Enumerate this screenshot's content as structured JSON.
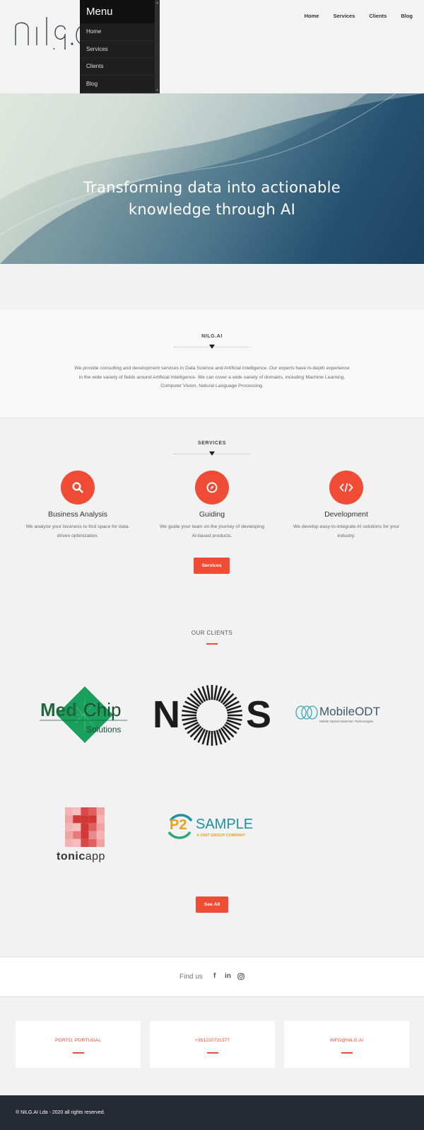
{
  "header": {
    "nav": [
      "Home",
      "Services",
      "Clients",
      "Blog"
    ]
  },
  "menu": {
    "title": "Menu",
    "items": [
      "Home",
      "Services",
      "Clients",
      "Blog"
    ]
  },
  "hero": {
    "line1": "Transforming data into actionable",
    "line2": "knowledge through AI"
  },
  "about": {
    "title": "NILG.AI",
    "text": "We provide consulting and development services in Data Science and Artificial Intelligence. Our experts have in-depth experience in the wide variety of fields around Artificial Intelligence. We can cover a wide variety of domains, including Machine Learning, Computer Vision, Natural Language Processing."
  },
  "services": {
    "title": "SERVICES",
    "items": [
      {
        "title": "Business Analysis",
        "desc": "We analyze your business to find space for data-driven optimization.",
        "icon": "search-icon"
      },
      {
        "title": "Guiding",
        "desc": "We guide your team on the journey of developing AI-based products.",
        "icon": "compass-icon"
      },
      {
        "title": "Development",
        "desc": "We develop easy-to-integrate AI solutions for your industry.",
        "icon": "code-icon"
      }
    ],
    "button": "Services"
  },
  "clients": {
    "title": "OUR CLIENTS",
    "medchip": {
      "med": "Med",
      "chip": "Chip",
      "solutions": "Solutions"
    },
    "nos": {
      "n": "N",
      "s": "S"
    },
    "mobileodt": {
      "name": "MobileODT",
      "tagline": "Mobile Optical Detection Technologies"
    },
    "tonicapp": {
      "tonic": "tonic",
      "app": "app"
    },
    "p2sample": {
      "p2": "P2",
      "sample": "SAMPLE",
      "tagline": "A GINT GROUP COMPANY"
    },
    "button": "See All"
  },
  "findus": {
    "label": "Find us",
    "facebook": "f",
    "linkedin": "in"
  },
  "contacts": [
    "PORTO, PORTUGAL",
    "+351220731377",
    "INFO@NILG.AI"
  ],
  "footer": {
    "text": "® NILG.AI Lda - 2020 all rights reserved."
  },
  "colors": {
    "accent": "#ef4b35",
    "footer": "#252a35",
    "menu": "#1e1e1e"
  }
}
